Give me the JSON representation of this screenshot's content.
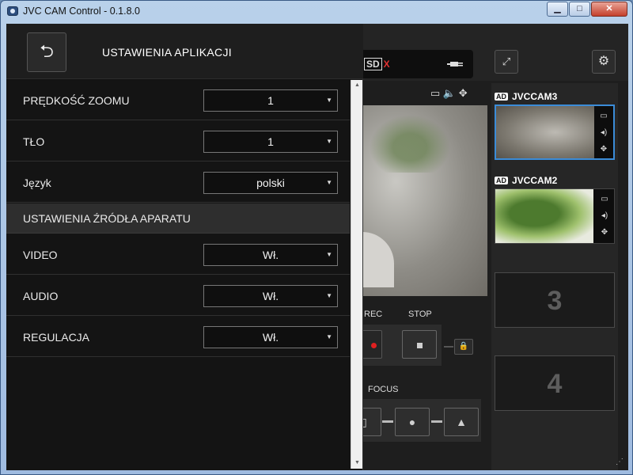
{
  "window": {
    "title": "JVC CAM Control - 0.1.8.0",
    "buttons": {
      "minimize": "▁",
      "maximize": "□",
      "close": "✕"
    }
  },
  "settings": {
    "title": "USTAWIENIA APLIKACJI",
    "back_icon": "back-arrow-icon",
    "rows": [
      {
        "label": "PRĘDKOŚĆ ZOOMU",
        "value": "1"
      },
      {
        "label": "TŁO",
        "value": "1"
      },
      {
        "label": "Język",
        "value": "polski"
      }
    ],
    "section_title": "USTAWIENIA ŹRÓDŁA APARATU",
    "source_rows": [
      {
        "label": "VIDEO",
        "value": "Wł."
      },
      {
        "label": "AUDIO",
        "value": "Wł."
      },
      {
        "label": "REGULACJA",
        "value": "Wł."
      }
    ]
  },
  "background_app": {
    "sd_label": "SD",
    "sd_status": "X",
    "rec_label": "REC",
    "stop_label": "STOP",
    "focus_label": "FOCUS",
    "cameras": [
      {
        "badge": "AD",
        "name": "JVCCAM3",
        "selected": true
      },
      {
        "badge": "AD",
        "name": "JVCCAM2",
        "selected": false
      }
    ],
    "empty_slots": [
      "3",
      "4"
    ]
  },
  "colors": {
    "selection_border": "#3b8cd8",
    "record_dot": "#e02020",
    "sd_error": "#e23131"
  }
}
